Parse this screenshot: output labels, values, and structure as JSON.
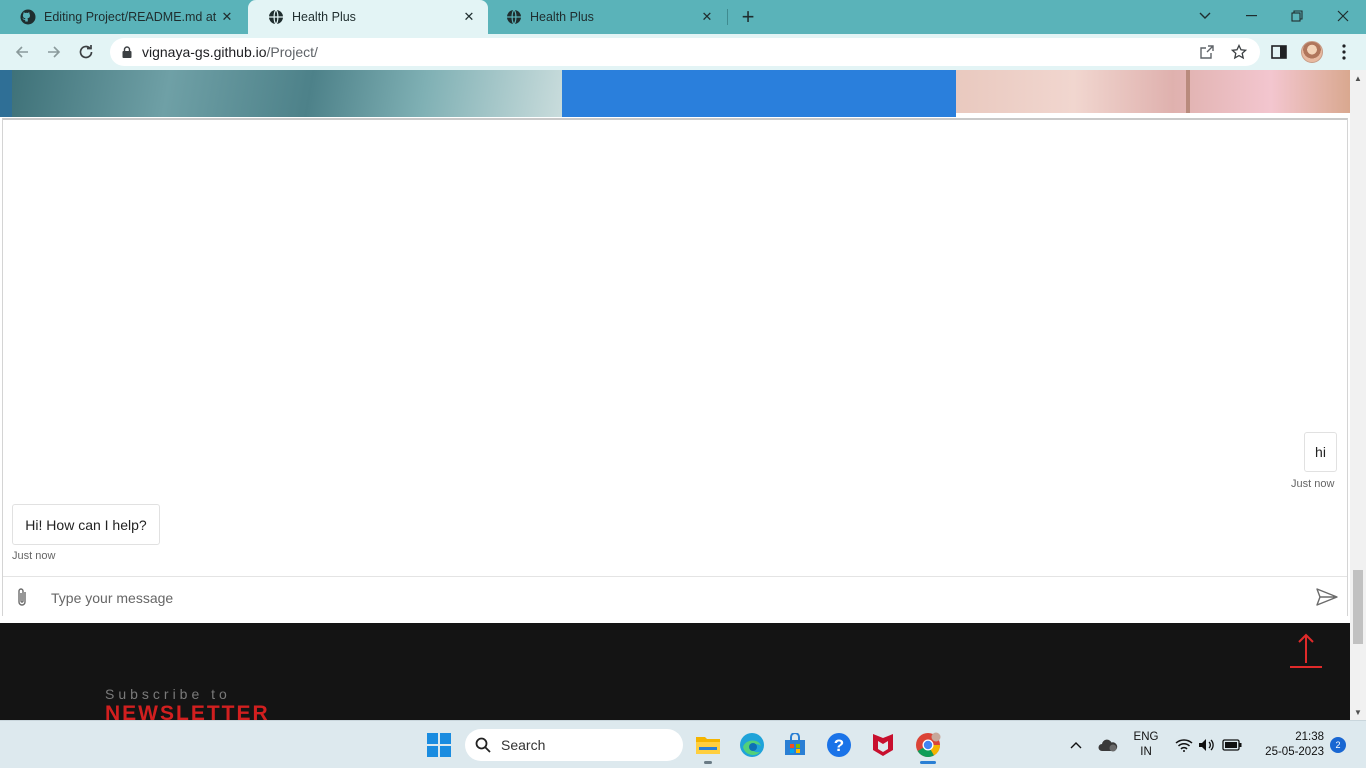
{
  "browser": {
    "tabs": [
      {
        "title": "Editing Project/README.md at m",
        "favicon": "github-icon",
        "active": false
      },
      {
        "title": "Health Plus",
        "favicon": "globe-icon",
        "active": true
      },
      {
        "title": "Health Plus",
        "favicon": "globe-icon",
        "active": false
      }
    ],
    "new_tab_label": "+",
    "url_host": "vignaya-gs.github.io",
    "url_path": "/Project/"
  },
  "chat": {
    "messages": [
      {
        "sender": "user",
        "text": "hi",
        "time": "Just now"
      },
      {
        "sender": "bot",
        "text": "Hi! How can I help?",
        "time": "Just now"
      }
    ],
    "input": {
      "placeholder": "Type your message",
      "value": ""
    }
  },
  "footer": {
    "subscribe_prefix": "Subscribe to",
    "subscribe_title": "NEWSLETTER"
  },
  "colors": {
    "tabstrip": "#5ab3b9",
    "toolbar": "#e3f4f5",
    "footer_bg": "#141414",
    "accent_red": "#d21f1f",
    "banner_blue": "#2a7fdc"
  },
  "taskbar": {
    "search_label": "Search",
    "language": "ENG",
    "region": "IN",
    "time": "21:38",
    "date": "25-05-2023",
    "notification_count": "2",
    "pinned": [
      "windows-start-icon",
      "file-explorer-icon",
      "edge-icon",
      "microsoft-store-icon",
      "help-icon",
      "mcafee-icon",
      "chrome-icon"
    ]
  }
}
